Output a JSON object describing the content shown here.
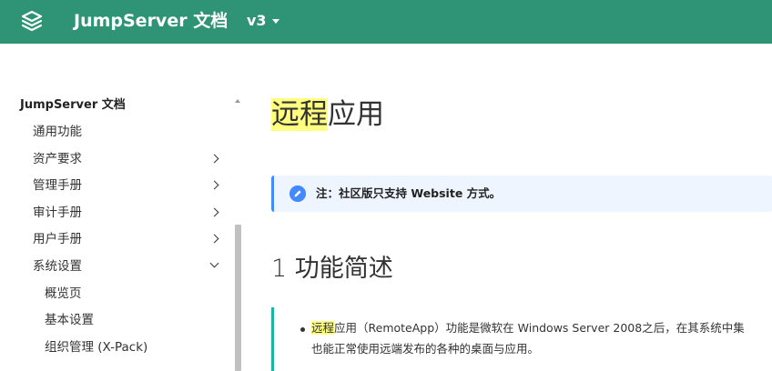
{
  "header": {
    "title": "JumpServer 文档",
    "version": "v3"
  },
  "sidebar": {
    "root": "JumpServer 文档",
    "items": [
      {
        "label": "通用功能",
        "chevron": "none"
      },
      {
        "label": "资产要求",
        "chevron": "right"
      },
      {
        "label": "管理手册",
        "chevron": "right"
      },
      {
        "label": "审计手册",
        "chevron": "right"
      },
      {
        "label": "用户手册",
        "chevron": "right"
      },
      {
        "label": "系统设置",
        "chevron": "down"
      }
    ],
    "subitems": [
      {
        "label": "概览页"
      },
      {
        "label": "基本设置"
      },
      {
        "label": "组织管理 (X-Pack)"
      }
    ]
  },
  "main": {
    "title_highlight": "远程",
    "title_rest": "应用",
    "note": "注：社区版只支持 Website 方式。",
    "section_heading": "1 功能简述",
    "desc_highlight": "远程",
    "desc_line1_rest": "应用（RemoteApp）功能是微软在 Windows Server 2008之后，在其系统中集",
    "desc_line2": "也能正常使用远端发布的各种的桌面与应用。"
  },
  "colors": {
    "header": "#2e9475",
    "note_accent": "#448aff",
    "block_accent": "#1ab5a3",
    "highlight": "#ffff80"
  }
}
